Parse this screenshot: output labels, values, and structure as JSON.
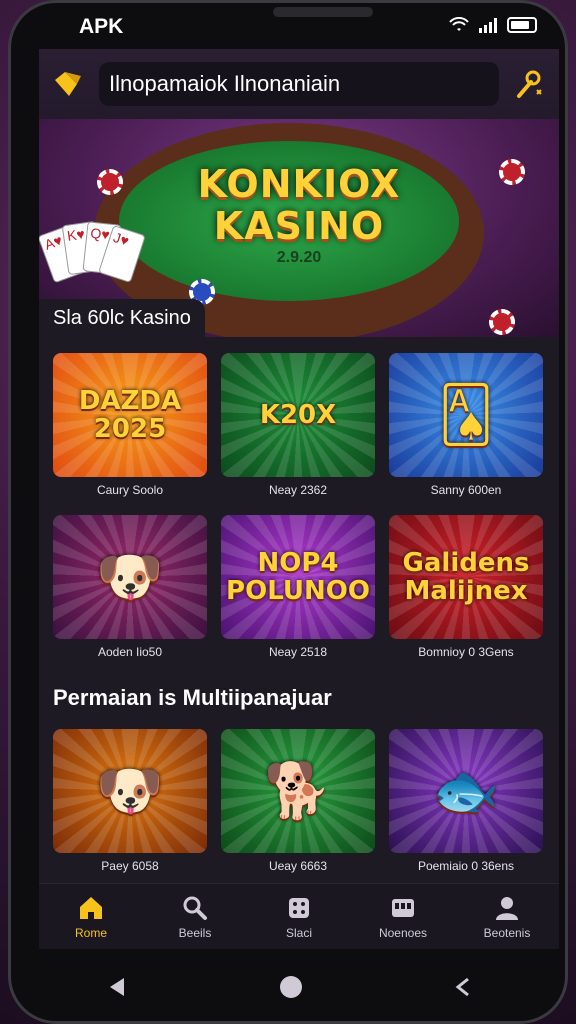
{
  "status_bar": {
    "carrier": "APK"
  },
  "header": {
    "app_title": "Ilnopamaiok Ilnonaniain"
  },
  "hero": {
    "title_line1": "KONKIOX",
    "title_line2": "KASINO",
    "subtitle": "2.9.20",
    "section_label": "Sla 60lc Kasino"
  },
  "games_top": [
    {
      "art": "DAZDA\n2025",
      "label": "Caury Soolo",
      "colors": [
        "#f7a01a",
        "#e04a12"
      ]
    },
    {
      "art": "K20X",
      "label": "Neay 2362",
      "colors": [
        "#1f8f3a",
        "#0c4a1c"
      ]
    },
    {
      "art": "🂡",
      "label": "Sanny 600en",
      "colors": [
        "#3a8fe8",
        "#1a3a9a"
      ]
    },
    {
      "art": "🐶",
      "label": "Aoden Iio50",
      "colors": [
        "#9a2a6a",
        "#3a1040"
      ]
    },
    {
      "art": "NOP4\nPOLUNOO",
      "label": "Neay 2518",
      "colors": [
        "#b03ad0",
        "#4a1270"
      ]
    },
    {
      "art": "Galidens\nMalijnex",
      "label": "Bomnioy 0 3Gens",
      "colors": [
        "#d0202a",
        "#6a0c12"
      ]
    }
  ],
  "section_multi": {
    "title": "Permaian is Multiipanajuar"
  },
  "games_bottom": [
    {
      "art": "🐶",
      "label": "Paey 6058",
      "colors": [
        "#e07a12",
        "#7a2a08"
      ]
    },
    {
      "art": "🐕",
      "label": "Ueay 6663",
      "colors": [
        "#2aa040",
        "#0c4a18"
      ]
    },
    {
      "art": "🐟",
      "label": "Poemiaio 0 36ens",
      "colors": [
        "#8a3ac8",
        "#2a1050"
      ]
    }
  ],
  "bottom_nav": [
    {
      "label": "Rome",
      "icon": "home-icon"
    },
    {
      "label": "Beeils",
      "icon": "search-icon"
    },
    {
      "label": "Slaci",
      "icon": "dice-icon"
    },
    {
      "label": "Noenoes",
      "icon": "slot-icon"
    },
    {
      "label": "Beotenis",
      "icon": "user-icon"
    }
  ],
  "accent_color": "#f7c21a"
}
